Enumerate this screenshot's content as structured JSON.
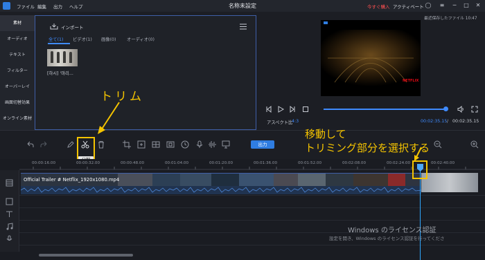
{
  "titlebar": {
    "menu": [
      "ファイル",
      "編集",
      "出力",
      "ヘルプ"
    ],
    "window_title": "名称未設定",
    "upgrade": "今すぐ購入",
    "activate": "アクティベート"
  },
  "sidebar": {
    "items": [
      {
        "label": "素材"
      },
      {
        "label": "オーディオ"
      },
      {
        "label": "テキスト"
      },
      {
        "label": "フィルター"
      },
      {
        "label": "オーバーレイ"
      },
      {
        "label": "画面切替効果"
      },
      {
        "label": "オンライン素材"
      }
    ]
  },
  "media": {
    "import_label": "インポート",
    "filters": [
      "全て(1)",
      "ビデオ(1)",
      "画像(0)",
      "オーディオ(0)"
    ],
    "items": [
      {
        "name": "[하시] '마리..."
      }
    ]
  },
  "preview": {
    "autosave": "最近保存したファイル 10:47",
    "aspect_label": "アスペクト比",
    "aspect_value": "4:3",
    "time_current": "00:02:35.15",
    "time_separator": "/",
    "time_total": "00:02:35.15",
    "progress": 0.98,
    "overlay_brand": "NETFLIX"
  },
  "toolbar": {
    "export_label": "出力",
    "split_tooltip": "分割"
  },
  "timeline": {
    "ticks": [
      "00:00:16.00",
      "00:00:32.00",
      "00:00:48.00",
      "00:01:04.00",
      "00:01:20.00",
      "00:01:36.00",
      "00:01:52.00",
      "00:02:08.00",
      "00:02:24.00",
      "00:02:40.00"
    ],
    "clip_name": "Official Trailer # Netflix_1920x1080.mp4"
  },
  "annotations": {
    "trim": "トリム",
    "move_line1": "移動して",
    "move_line2": "トリミング部分を選択する"
  },
  "watermark": {
    "title": "Windows のライセンス認証",
    "subtitle": "設定を開き、Windows のライセンス認証を行ってくださ"
  },
  "colors": {
    "accent": "#3f8bff",
    "annotation": "#f5c400"
  }
}
